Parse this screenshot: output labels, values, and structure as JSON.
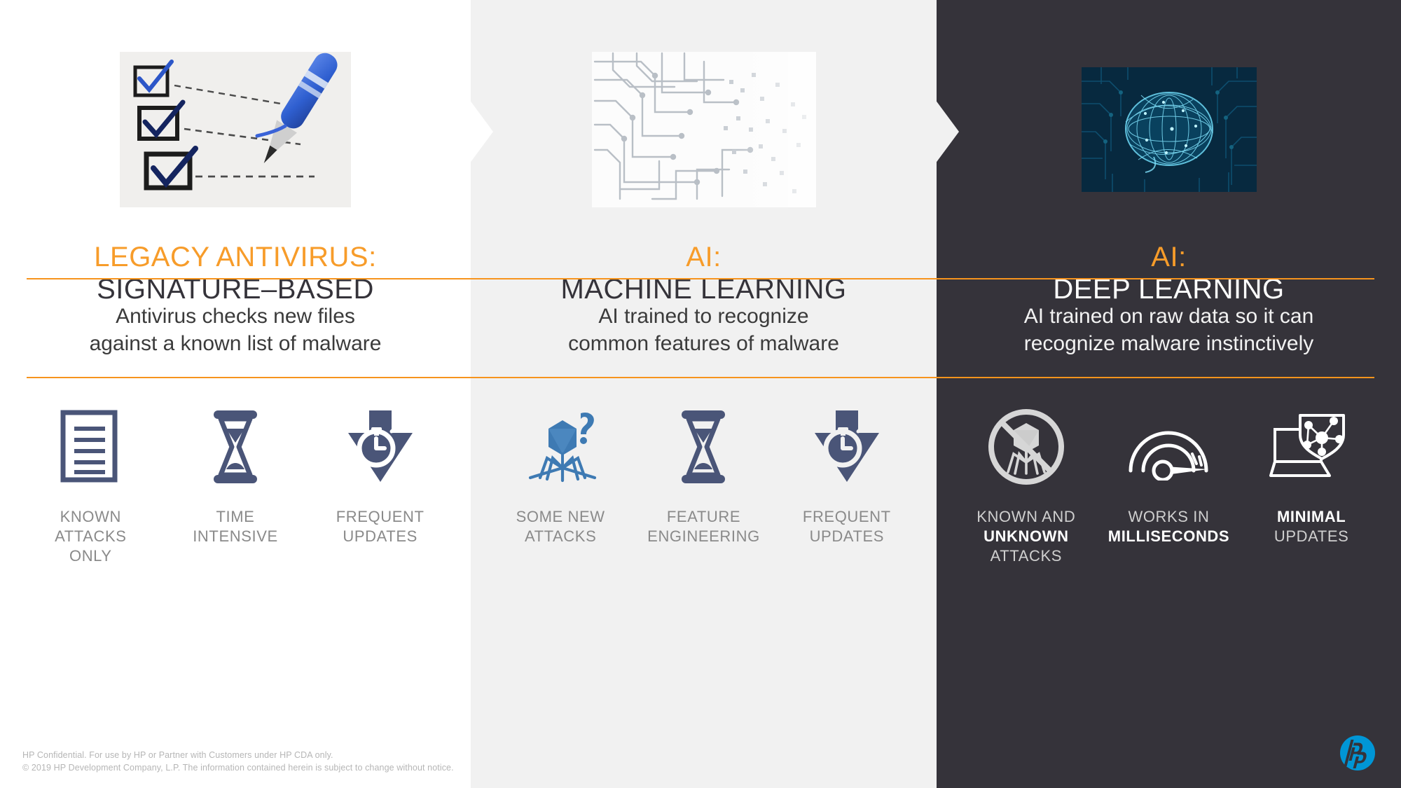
{
  "slide": {
    "theme": {
      "accent_orange": "#f7941d",
      "dark_panel": "#35333a",
      "mid_panel": "#f1f1f1",
      "light_panel": "#ffffff",
      "icon_navy": "#4a5578",
      "icon_blue": "#3e7ab3",
      "hp_blue": "#0096d6",
      "muted_label": "#8a8a8a"
    },
    "columns": [
      {
        "id": "legacy-antivirus",
        "hero_icon": "checklist-photo",
        "title_top": "LEGACY ANTIVIRUS:",
        "title_bottom": "SIGNATURE–BASED",
        "description": [
          "Antivirus checks new files",
          "against a known list of malware"
        ],
        "features": [
          {
            "icon": "document-lines-icon",
            "lines": [
              {
                "text": "KNOWN",
                "bold": false
              },
              {
                "text": "ATTACKS",
                "bold": false
              },
              {
                "text": "ONLY",
                "bold": false
              }
            ]
          },
          {
            "icon": "hourglass-icon",
            "lines": [
              {
                "text": "TIME",
                "bold": false
              },
              {
                "text": "INTENSIVE",
                "bold": false
              }
            ]
          },
          {
            "icon": "download-timer-icon",
            "lines": [
              {
                "text": "FREQUENT",
                "bold": false
              },
              {
                "text": "UPDATES",
                "bold": false
              }
            ]
          }
        ]
      },
      {
        "id": "ai-machine-learning",
        "hero_icon": "circuit-board-photo",
        "title_top": "AI:",
        "title_bottom": "MACHINE LEARNING",
        "description": [
          "AI trained to recognize",
          "common features of malware"
        ],
        "features": [
          {
            "icon": "virus-question-icon",
            "lines": [
              {
                "text": "SOME NEW",
                "bold": false
              },
              {
                "text": "ATTACKS",
                "bold": false
              }
            ]
          },
          {
            "icon": "hourglass-icon",
            "lines": [
              {
                "text": "FEATURE",
                "bold": false
              },
              {
                "text": "ENGINEERING",
                "bold": false
              }
            ]
          },
          {
            "icon": "download-timer-icon",
            "lines": [
              {
                "text": "FREQUENT",
                "bold": false
              },
              {
                "text": "UPDATES",
                "bold": false
              }
            ]
          }
        ]
      },
      {
        "id": "ai-deep-learning",
        "hero_icon": "brain-circuit-photo",
        "title_top": "AI:",
        "title_bottom": "DEEP LEARNING",
        "description": [
          "AI trained on raw data so it can",
          "recognize malware instinctively"
        ],
        "features": [
          {
            "icon": "no-virus-icon",
            "lines": [
              {
                "text": "KNOWN AND",
                "bold": false
              },
              {
                "text": "UNKNOWN",
                "bold": true
              },
              {
                "text": "ATTACKS",
                "bold": false
              }
            ]
          },
          {
            "icon": "speedometer-icon",
            "lines": [
              {
                "text": "WORKS IN",
                "bold": false
              },
              {
                "text": "MILLISECONDS",
                "bold": true
              }
            ]
          },
          {
            "icon": "laptop-shield-icon",
            "lines": [
              {
                "text": "MINIMAL",
                "bold": true
              },
              {
                "text": "UPDATES",
                "bold": false
              }
            ]
          }
        ]
      }
    ],
    "footer": {
      "line1": "HP Confidential. For use by HP or Partner with Customers under HP CDA only.",
      "line2": "© 2019 HP Development Company, L.P. The information contained herein is subject to change without notice.",
      "logo": "hp-logo"
    }
  }
}
